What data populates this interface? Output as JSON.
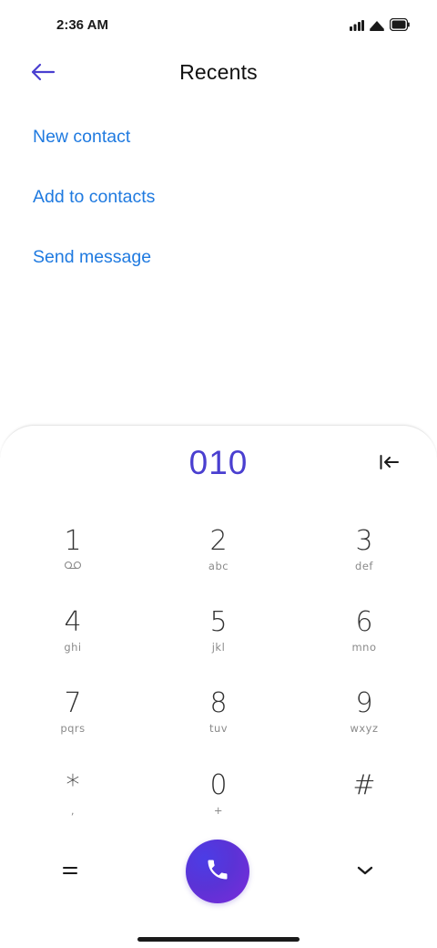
{
  "status_bar": {
    "time": "2:36 AM",
    "icons": [
      "signal-icon",
      "wifi-icon",
      "battery-icon"
    ]
  },
  "header": {
    "title": "Recents",
    "back_icon": "arrow-left-icon"
  },
  "actions": [
    {
      "label": "New contact"
    },
    {
      "label": "Add to contacts"
    },
    {
      "label": "Send message"
    }
  ],
  "dialer": {
    "number": "010",
    "backspace_icon": "backspace-icon",
    "keys": [
      {
        "digit": "1",
        "letters": ""
      },
      {
        "digit": "2",
        "letters": "abc"
      },
      {
        "digit": "3",
        "letters": "def"
      },
      {
        "digit": "4",
        "letters": "ghi"
      },
      {
        "digit": "5",
        "letters": "jkl"
      },
      {
        "digit": "6",
        "letters": "mno"
      },
      {
        "digit": "7",
        "letters": "pqrs"
      },
      {
        "digit": "8",
        "letters": "tuv"
      },
      {
        "digit": "9",
        "letters": "wxyz"
      },
      {
        "digit": "*",
        "letters": ","
      },
      {
        "digit": "0",
        "letters": "+"
      },
      {
        "digit": "#",
        "letters": ""
      }
    ],
    "call_icon": "phone-icon",
    "menu_icon": "menu-icon",
    "collapse_icon": "chevron-down-icon"
  },
  "colors": {
    "accent": "#1f7ae0",
    "number": "#4a3fd0",
    "call_gradient_start": "#4b3de6",
    "call_gradient_end": "#7b2bd9"
  }
}
